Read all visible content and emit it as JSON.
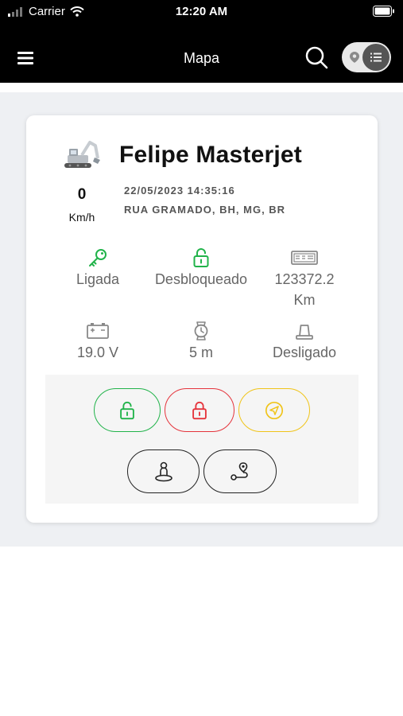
{
  "status_bar": {
    "carrier": "Carrier",
    "time": "12:20 AM"
  },
  "nav": {
    "title": "Mapa",
    "view_toggle_state": "list"
  },
  "vehicle": {
    "name": "Felipe Masterjet",
    "speed_value": "0",
    "speed_unit": "Km/h",
    "datetime": "22/05/2023 14:35:16",
    "address": "RUA GRAMADO, BH, MG, BR"
  },
  "stats": [
    {
      "icon": "key-icon",
      "label": "Ligada",
      "color": "#21b34a"
    },
    {
      "icon": "unlock-icon",
      "label": "Desbloqueado",
      "color": "#21b34a"
    },
    {
      "icon": "odometer-icon",
      "label": "123372.2\nKm",
      "color": "#888888"
    },
    {
      "icon": "battery-icon",
      "label": "19.0 V",
      "color": "#888888"
    },
    {
      "icon": "watch-icon",
      "label": "5 m",
      "color": "#888888"
    },
    {
      "icon": "siren-icon",
      "label": "Desligado",
      "color": "#888888"
    }
  ],
  "action_buttons": [
    {
      "icon": "unlock-icon",
      "color": "#21b34a"
    },
    {
      "icon": "lock-icon",
      "color": "#e5343c"
    },
    {
      "icon": "navigation-icon",
      "color": "#f0c419"
    },
    {
      "icon": "person-location-icon",
      "color": "#222222"
    },
    {
      "icon": "route-icon",
      "color": "#222222"
    }
  ]
}
